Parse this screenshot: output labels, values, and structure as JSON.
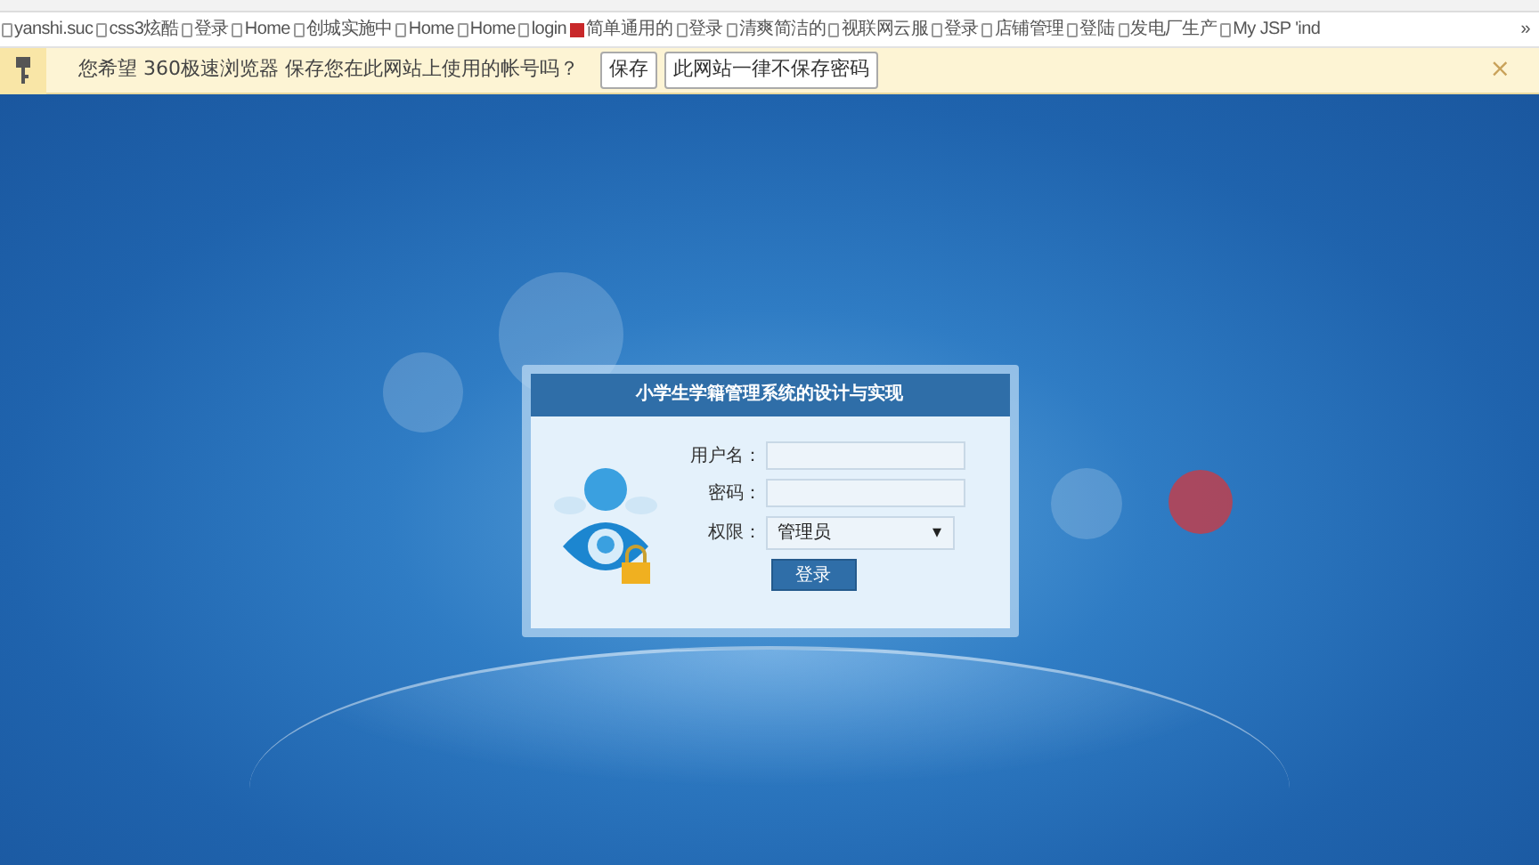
{
  "bookmarks": [
    {
      "label": "yanshi.suc"
    },
    {
      "label": "css3炫酷"
    },
    {
      "label": "登录"
    },
    {
      "label": "Home"
    },
    {
      "label": "创城实施中"
    },
    {
      "label": "Home"
    },
    {
      "label": "Home"
    },
    {
      "label": "login"
    },
    {
      "label": "简单通用的",
      "kind": "brand"
    },
    {
      "label": "登录"
    },
    {
      "label": "清爽简洁的"
    },
    {
      "label": "视联网云服"
    },
    {
      "label": "登录"
    },
    {
      "label": "店铺管理"
    },
    {
      "label": "登陆"
    },
    {
      "label": "发电厂生产"
    },
    {
      "label": "My JSP 'ind"
    }
  ],
  "bookmarks_more": "»",
  "password_prompt": {
    "message": "您希望 360极速浏览器 保存您在此网站上使用的帐号吗？",
    "buttons": [
      "保存",
      "此网站一律不保存密码"
    ],
    "close": "×"
  },
  "login": {
    "title": "小学生学籍管理系统的设计与实现",
    "fields": [
      {
        "label": "用户名：",
        "kind": "text"
      },
      {
        "label": "密码：",
        "kind": "password"
      },
      {
        "label": "权限：",
        "kind": "select",
        "value": "管理员",
        "caret": "▾"
      }
    ],
    "submit": "登录"
  }
}
